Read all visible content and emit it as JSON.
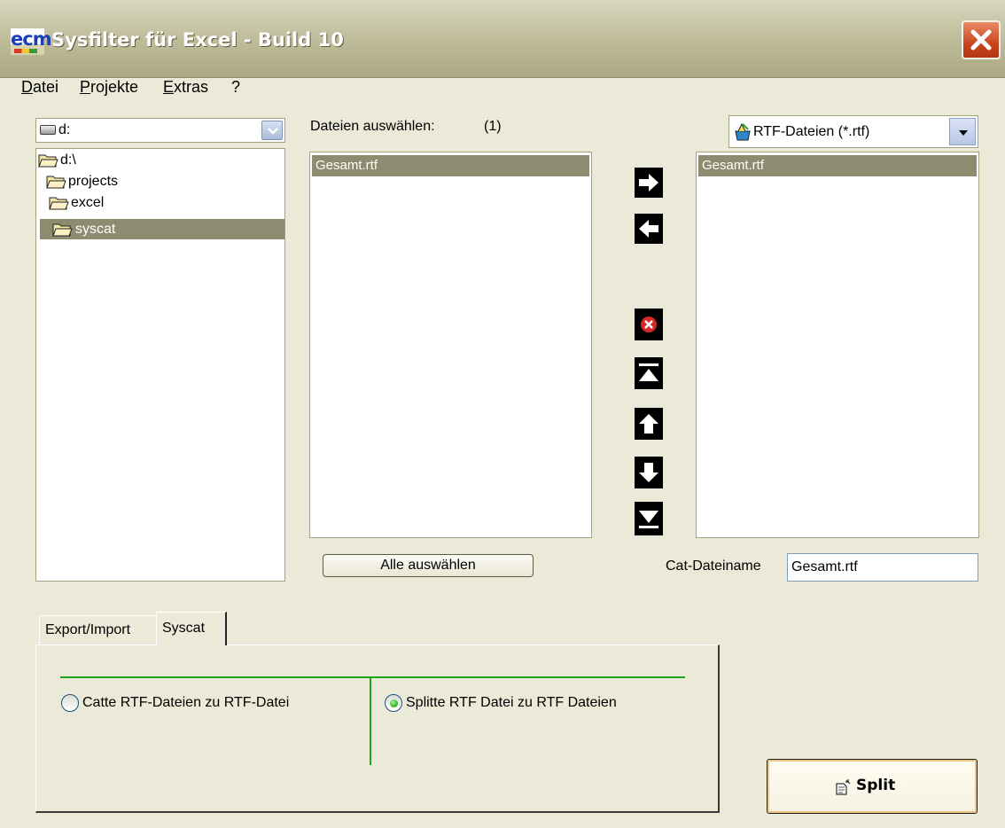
{
  "window": {
    "title": "Sysfilter für Excel - Build 10",
    "logo_text": "ecm"
  },
  "menu": {
    "items": [
      {
        "accel": "D",
        "rest": "atei"
      },
      {
        "accel": "P",
        "rest": "rojekte"
      },
      {
        "accel": "E",
        "rest": "xtras"
      },
      {
        "accel": "",
        "rest": "?"
      }
    ]
  },
  "drive": {
    "value": "d:",
    "icon": "drive-icon"
  },
  "folders": {
    "items": [
      {
        "label": "d:\\",
        "icon": "open-folder-icon",
        "selected": false
      },
      {
        "label": "projects",
        "icon": "open-folder-icon",
        "selected": false
      },
      {
        "label": "excel",
        "icon": "open-folder-icon",
        "selected": false
      },
      {
        "label": "syscat",
        "icon": "open-folder-icon",
        "selected": true
      }
    ]
  },
  "files": {
    "header": "Dateien auswählen:",
    "count": "(1)",
    "items": [
      "Gesamt.rtf"
    ],
    "select_all_label": "Alle auswählen"
  },
  "filter": {
    "value": "RTF-Dateien (*.rtf)",
    "icon": "file-filter-icon"
  },
  "selected_files": {
    "items": [
      "Gesamt.rtf"
    ]
  },
  "cat_filename": {
    "label": "Cat-Dateiname",
    "value": "Gesamt.rtf"
  },
  "tabs": [
    {
      "label": "Export/Import",
      "active": false
    },
    {
      "label": "Syscat",
      "active": true
    }
  ],
  "options": [
    {
      "label": "Catte RTF-Dateien zu RTF-Datei",
      "checked": false
    },
    {
      "label": "Splitte RTF Datei zu RTF Dateien",
      "checked": true
    }
  ],
  "action_button": {
    "label": "Split",
    "icon": "split-icon"
  },
  "colors": {
    "selection": "#8d8c70",
    "accent_green": "#1ea319",
    "close_red": "#c8471f"
  }
}
